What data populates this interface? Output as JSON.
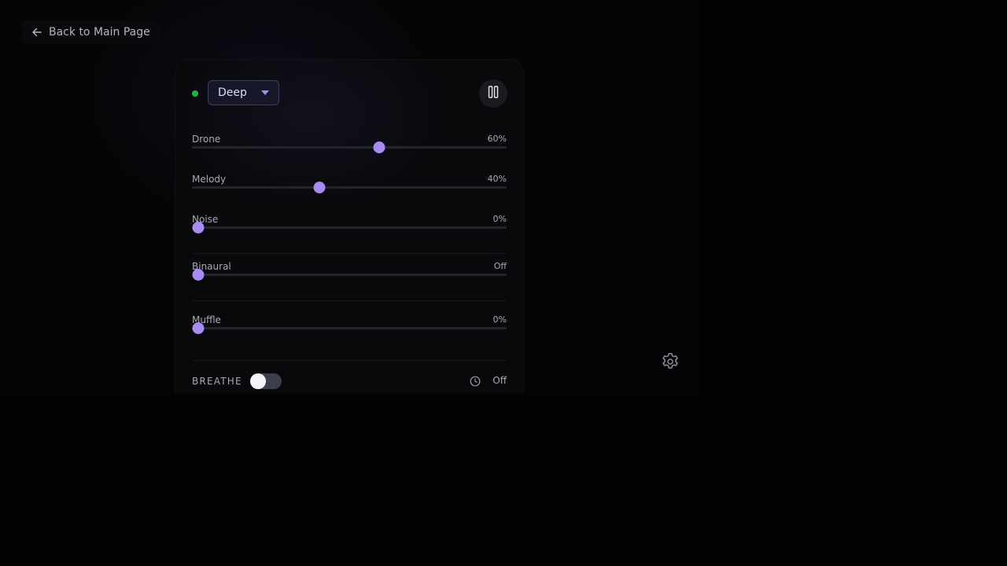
{
  "navigation": {
    "back_label": "Back to Main Page"
  },
  "player": {
    "preset": "Deep",
    "status_color": "#23b34d",
    "accent_color": "#a88bf2",
    "playing": true,
    "controls": [
      {
        "name": "Drone",
        "value_label": "60%",
        "value": 0.6
      },
      {
        "name": "Melody",
        "value_label": "40%",
        "value": 0.4
      },
      {
        "name": "Noise",
        "value_label": "0%",
        "value": 0.0
      },
      {
        "name": "Binaural",
        "value_label": "Off",
        "value": 0.0
      },
      {
        "name": "Muffle",
        "value_label": "0%",
        "value": 0.0
      }
    ],
    "breathe": {
      "label": "BREATHE",
      "enabled": false
    },
    "timer": {
      "icon": "clock-icon",
      "value": "Off"
    }
  },
  "icons": {
    "back": "arrow-left-icon",
    "pause": "pause-icon",
    "dropdown": "chevron-down-icon",
    "settings": "gear-icon"
  }
}
